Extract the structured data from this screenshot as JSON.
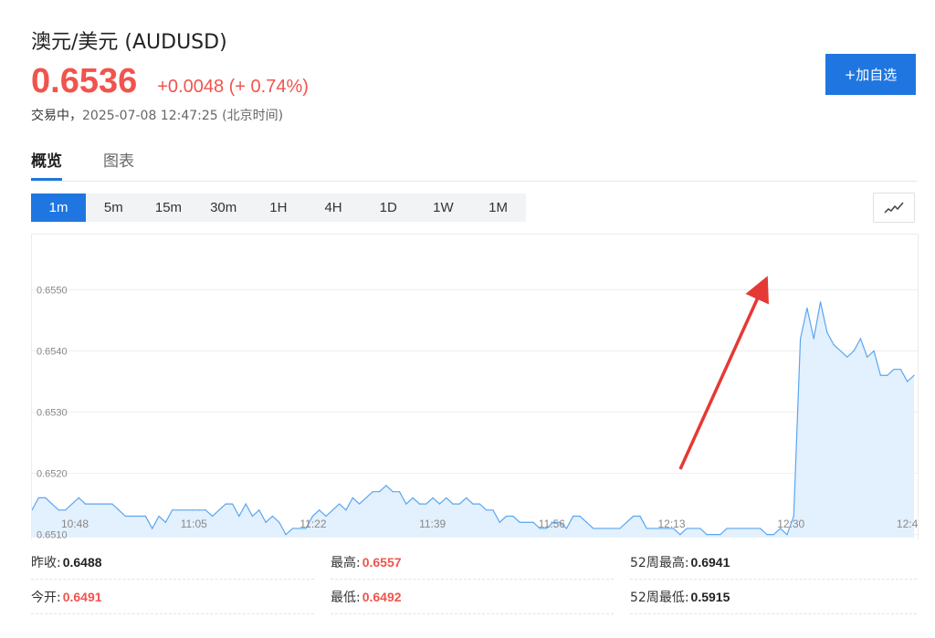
{
  "header": {
    "title": "澳元/美元  (AUDUSD)",
    "price": "0.6536",
    "change": "+0.0048 (+ 0.74%)",
    "status_label": "交易中，",
    "timestamp": "2025-07-08 12:47:25 (北京时间)",
    "add_button": "+加自选"
  },
  "tabs": [
    {
      "label": "概览",
      "active": true
    },
    {
      "label": "图表",
      "active": false
    }
  ],
  "periods": [
    {
      "label": "1m",
      "active": true
    },
    {
      "label": "5m",
      "active": false
    },
    {
      "label": "15m",
      "active": false
    },
    {
      "label": "30m",
      "active": false
    },
    {
      "label": "1H",
      "active": false
    },
    {
      "label": "4H",
      "active": false
    },
    {
      "label": "1D",
      "active": false
    },
    {
      "label": "1W",
      "active": false
    },
    {
      "label": "1M",
      "active": false
    }
  ],
  "chart_type_icon": "line-chart-icon",
  "colors": {
    "up": "#f0544d",
    "accent": "#1f76e0",
    "line": "#5aa6f0",
    "area": "#e3f0fd",
    "arrow": "#e53935"
  },
  "chart_data": {
    "type": "area",
    "title": "",
    "xlabel": "",
    "ylabel": "",
    "y_ticks": [
      "0.6550",
      "0.6540",
      "0.6530",
      "0.6520",
      "0.6510"
    ],
    "x_ticks": [
      "10:48",
      "11:05",
      "11:22",
      "11:39",
      "11:56",
      "12:13",
      "12:30",
      "12:4"
    ],
    "ylim": [
      0.65095,
      0.6559
    ],
    "grid": true,
    "legend": "none",
    "annotation": "red arrow pointing up toward the price spike",
    "series": [
      {
        "values": [
          0.6514,
          0.6516,
          0.6516,
          0.6515,
          0.6514,
          0.6514,
          0.6515,
          0.6516,
          0.6515,
          0.6515,
          0.6515,
          0.6515,
          0.6515,
          0.6514,
          0.6513,
          0.6513,
          0.6513,
          0.6513,
          0.6511,
          0.6513,
          0.6512,
          0.6514,
          0.6514,
          0.6514,
          0.6514,
          0.6514,
          0.6514,
          0.6513,
          0.6514,
          0.6515,
          0.6515,
          0.6513,
          0.6515,
          0.6513,
          0.6514,
          0.6512,
          0.6513,
          0.6512,
          0.651,
          0.6511,
          0.6511,
          0.6511,
          0.6513,
          0.6514,
          0.6513,
          0.6514,
          0.6515,
          0.6514,
          0.6516,
          0.6515,
          0.6516,
          0.6517,
          0.6517,
          0.6518,
          0.6517,
          0.6517,
          0.6515,
          0.6516,
          0.6515,
          0.6515,
          0.6516,
          0.6515,
          0.6516,
          0.6515,
          0.6515,
          0.6516,
          0.6515,
          0.6515,
          0.6514,
          0.6514,
          0.6512,
          0.6513,
          0.6513,
          0.6512,
          0.6512,
          0.6512,
          0.6511,
          0.6511,
          0.6512,
          0.6512,
          0.6511,
          0.6513,
          0.6513,
          0.6512,
          0.6511,
          0.6511,
          0.6511,
          0.6511,
          0.6511,
          0.6512,
          0.6513,
          0.6513,
          0.6511,
          0.6511,
          0.6511,
          0.6511,
          0.6511,
          0.651,
          0.6511,
          0.6511,
          0.6511,
          0.651,
          0.651,
          0.651,
          0.6511,
          0.6511,
          0.6511,
          0.6511,
          0.6511,
          0.6511,
          0.651,
          0.651,
          0.6511,
          0.651,
          0.6513,
          0.6542,
          0.6547,
          0.6542,
          0.6548,
          0.6543,
          0.6541,
          0.654,
          0.6539,
          0.654,
          0.6542,
          0.6539,
          0.654,
          0.6536,
          0.6536,
          0.6537,
          0.6537,
          0.6535,
          0.6536
        ]
      }
    ]
  },
  "stats": {
    "prev_close_label": "昨收:",
    "prev_close": "0.6488",
    "high_label": "最高:",
    "high": "0.6557",
    "high_52w_label": "52周最高:",
    "high_52w": "0.6941",
    "open_label": "今开:",
    "open": "0.6491",
    "low_label": "最低:",
    "low": "0.6492",
    "low_52w_label": "52周最低:",
    "low_52w": "0.5915"
  }
}
